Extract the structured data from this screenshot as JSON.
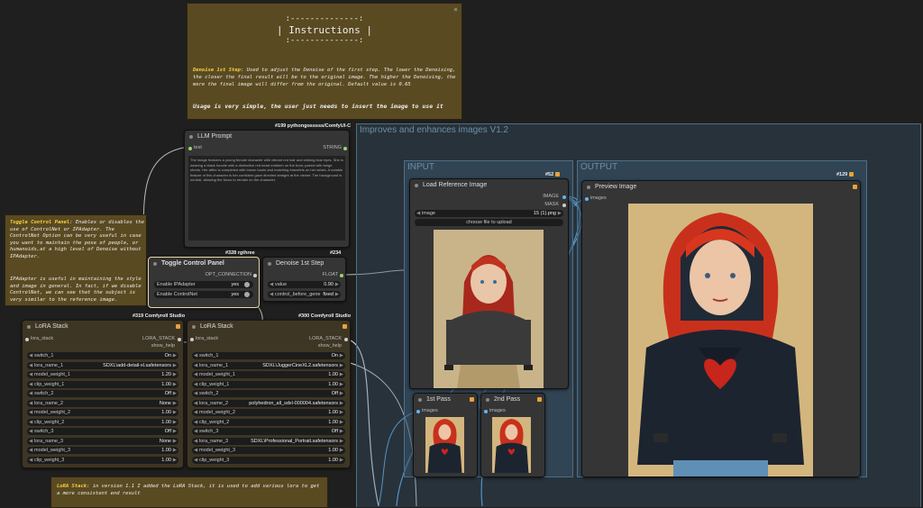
{
  "instructions": {
    "heading_top": ":--------------:",
    "heading": "| Instructions |",
    "heading_bottom": ":--------------:",
    "denoise_label": "Denoise 1st Step",
    "denoise_text": ": Used to adjust the Denoise of the first step. The lower the Denoising, the closer the final result will be to the original image. The higher the Denoising, the more the final image will differ from the original. Default value is 0.65",
    "usage": "Usage is very simple, the user just needs to insert the image to use it"
  },
  "llm_node": {
    "id": "#199 pythongosssss/ComfyUI-C",
    "title": "LLM Prompt",
    "input": "text",
    "output": "STRING",
    "text": "The image features a young female character with vibrant red hair and striking blue eyes. She is wearing a black hoodie with a distinctive red heart emblem on the front, paired with beige shorts. Her attire is completed with brown boots and matching bracelets on her wrists. A notable feature of this character is her confident gaze directed straight at the viewer. The background is neutral, allowing the focus to remain on the character."
  },
  "toggle_note": {
    "label": "Toggle Control Panel",
    "text": ": Enables or disables the use of ControlNet or IPAdapter. The ControlNet Option can be very useful in case you want to maintain the pose of people, or humanoids,at a high level of Denoise without IPAdapter.",
    "text2": "IPAdapter is useful in maintaining the style and image in general. In fact, if we disable ControlNet, we can see that the subject is very similar to the reference image."
  },
  "toggle_node": {
    "id": "#328 rgthree",
    "title": "Toggle Control Panel",
    "output": "OPT_CONNECTION",
    "rows": [
      {
        "label": "Enable IPAdapter",
        "value": "yes"
      },
      {
        "label": "Enable ControlNet",
        "value": "yes"
      }
    ]
  },
  "denoise_node": {
    "id": "#234",
    "title": "Denoise 1st Step",
    "output": "FLOAT",
    "rows": [
      {
        "label": "value",
        "value": "0.90"
      },
      {
        "label": "control_before_gene",
        "value": "fixed"
      }
    ]
  },
  "lora1": {
    "id": "#319 Comfyroll Studio",
    "title": "LoRA Stack",
    "input": "lora_stack",
    "output": "LORA_STACK",
    "output2": "show_help",
    "rows": [
      {
        "label": "switch_1",
        "value": "On"
      },
      {
        "label": "lora_name_1",
        "value": "SDXL\\add-detail-xl.safetensors"
      },
      {
        "label": "model_weight_1",
        "value": "1.20"
      },
      {
        "label": "clip_weight_1",
        "value": "1.00"
      },
      {
        "label": "switch_2",
        "value": "Off"
      },
      {
        "label": "lora_name_2",
        "value": "None"
      },
      {
        "label": "model_weight_2",
        "value": "1.00"
      },
      {
        "label": "clip_weight_2",
        "value": "1.00"
      },
      {
        "label": "switch_3",
        "value": "Off"
      },
      {
        "label": "lora_name_3",
        "value": "None"
      },
      {
        "label": "model_weight_3",
        "value": "1.00"
      },
      {
        "label": "clip_weight_3",
        "value": "1.00"
      }
    ]
  },
  "lora2": {
    "id": "#300 Comfyroll Studio",
    "title": "LoRA Stack",
    "input": "lora_stack",
    "output": "LORA_STACK",
    "output2": "show_help",
    "rows": [
      {
        "label": "switch_1",
        "value": "On"
      },
      {
        "label": "lora_name_1",
        "value": "SDXL\\JuggerCineXL2.safetensors"
      },
      {
        "label": "model_weight_1",
        "value": "1.00"
      },
      {
        "label": "clip_weight_1",
        "value": "1.00"
      },
      {
        "label": "switch_2",
        "value": "Off"
      },
      {
        "label": "lora_name_2",
        "value": "polyhedron_all_sdxl-000004.safetensors"
      },
      {
        "label": "model_weight_2",
        "value": "1.00"
      },
      {
        "label": "clip_weight_2",
        "value": "1.00"
      },
      {
        "label": "switch_3",
        "value": "Off"
      },
      {
        "label": "lora_name_3",
        "value": "SDXL\\Professional_Portrait.safetensors"
      },
      {
        "label": "model_weight_3",
        "value": "1.00"
      },
      {
        "label": "clip_weight_3",
        "value": "1.00"
      }
    ]
  },
  "lora_note": {
    "label": "LoRA Stack",
    "text": ": in version 1.1 I added the LoRA Stack, it is used to add various lora to get a more consistent end result"
  },
  "main_group": {
    "title": "Improves and enhances images V1.2"
  },
  "input_group": {
    "title": "INPUT"
  },
  "output_group": {
    "title": "OUTPUT"
  },
  "load_node": {
    "id": "#52",
    "title": "Load Reference Image",
    "out1": "IMAGE",
    "out2": "MASK",
    "image_label": "image",
    "image_value": "15 (1).png",
    "upload": "choose file to upload"
  },
  "preview_node": {
    "id": "#129",
    "title": "Preview Image",
    "input": "images"
  },
  "pass1": {
    "title": "1st Pass",
    "input": "images"
  },
  "pass2": {
    "title": "2nd Pass",
    "input": "images"
  },
  "colors": {
    "canvas": "#1f1f1f",
    "node": "#353535",
    "brown_node": "#3d3624",
    "note": "#5a4a22",
    "group": "#38566e",
    "accent_yellow": "#f5d042",
    "wire_blue": "#64b5f6"
  }
}
